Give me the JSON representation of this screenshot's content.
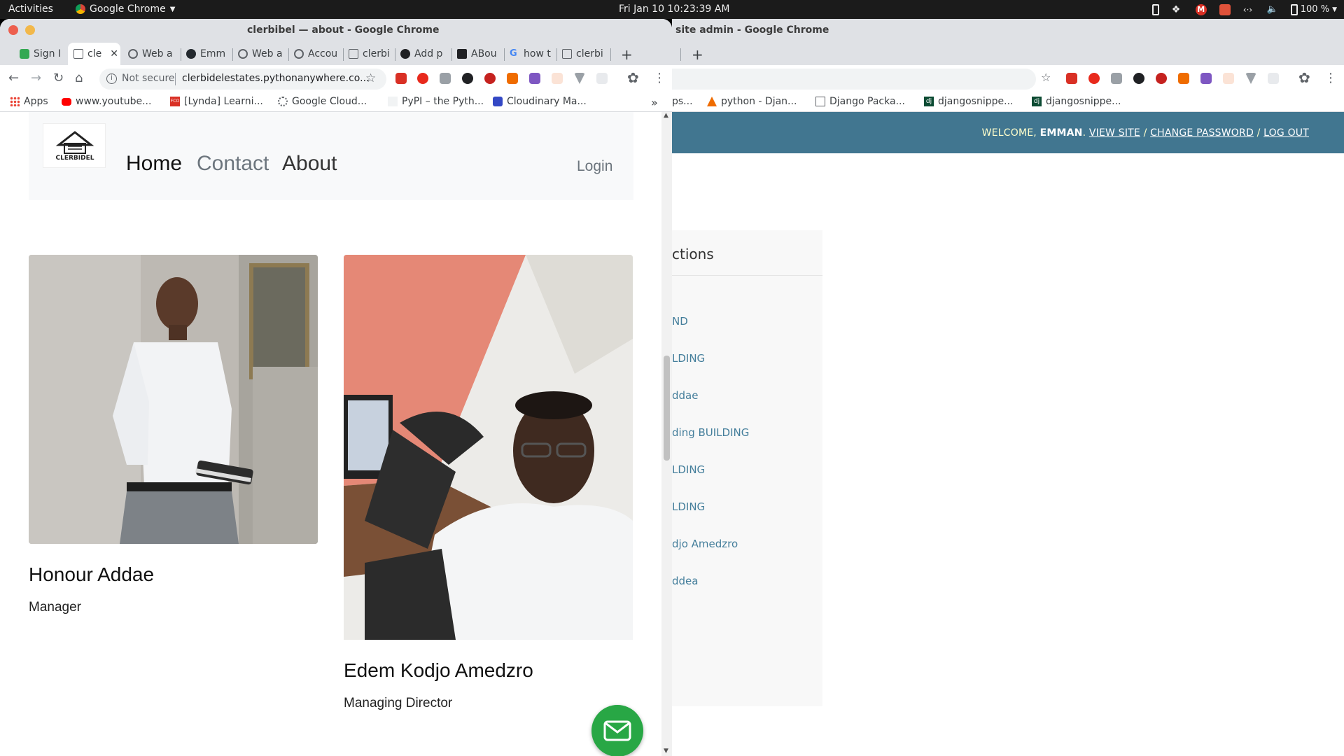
{
  "topbar": {
    "activities": "Activities",
    "app_name": "Google Chrome",
    "clock": "Fri Jan 10  10:23:39 AM",
    "battery": "100 %"
  },
  "left_window": {
    "title": "clerbibel — about - Google Chrome",
    "tabs": [
      {
        "label": "Sign I"
      },
      {
        "label": "cle"
      },
      {
        "label": "Web a"
      },
      {
        "label": "Emm"
      },
      {
        "label": "Web a"
      },
      {
        "label": "Accou"
      },
      {
        "label": "clerbi"
      },
      {
        "label": "Add p"
      },
      {
        "label": "ABou"
      },
      {
        "label": "how t"
      },
      {
        "label": "clerbi"
      }
    ],
    "new_tab": "+",
    "omnibox": {
      "security": "Not secure",
      "url": "clerbidelestates.pythonanywhere.co..."
    },
    "bookmarks": [
      {
        "label": "Apps"
      },
      {
        "label": "www.youtube..."
      },
      {
        "label": "[Lynda] Learni..."
      },
      {
        "label": "Google Cloud..."
      },
      {
        "label": "PyPI – the Pyth..."
      },
      {
        "label": "Cloudinary Ma..."
      }
    ],
    "bookmarks_more": "»",
    "page": {
      "logo_text": "CLERBIDEL",
      "nav": {
        "home": "Home",
        "contact": "Contact",
        "about": "About",
        "login": "Login"
      },
      "team": [
        {
          "name": "Honour Addae",
          "role": "Manager"
        },
        {
          "name": "Edem Kodjo Amedzro",
          "role": "Managing Director"
        }
      ]
    }
  },
  "right_window": {
    "title": "site admin - Google Chrome",
    "new_tab": "+",
    "bookmarks": [
      {
        "label": "ps..."
      },
      {
        "label": "python - Djan..."
      },
      {
        "label": "Django Packa..."
      },
      {
        "label": "djangosnippe..."
      },
      {
        "label": "djangosnippe..."
      }
    ],
    "admin": {
      "welcome": "WELCOME,",
      "username": "EMMAN",
      "view_site": "VIEW SITE",
      "change_password": "CHANGE PASSWORD",
      "log_out": "LOG OUT",
      "module_title": "ctions",
      "actions": [
        "ND",
        "LDING",
        "ddae",
        "ding BUILDING",
        "LDING",
        "LDING",
        "djo Amedzro",
        "ddea"
      ]
    }
  },
  "colors": {
    "admin_header": "#417690",
    "admin_link": "#447e9b",
    "fab_green": "#28a745",
    "nav_active": "#111111",
    "nav_inactive": "#6c757d"
  }
}
